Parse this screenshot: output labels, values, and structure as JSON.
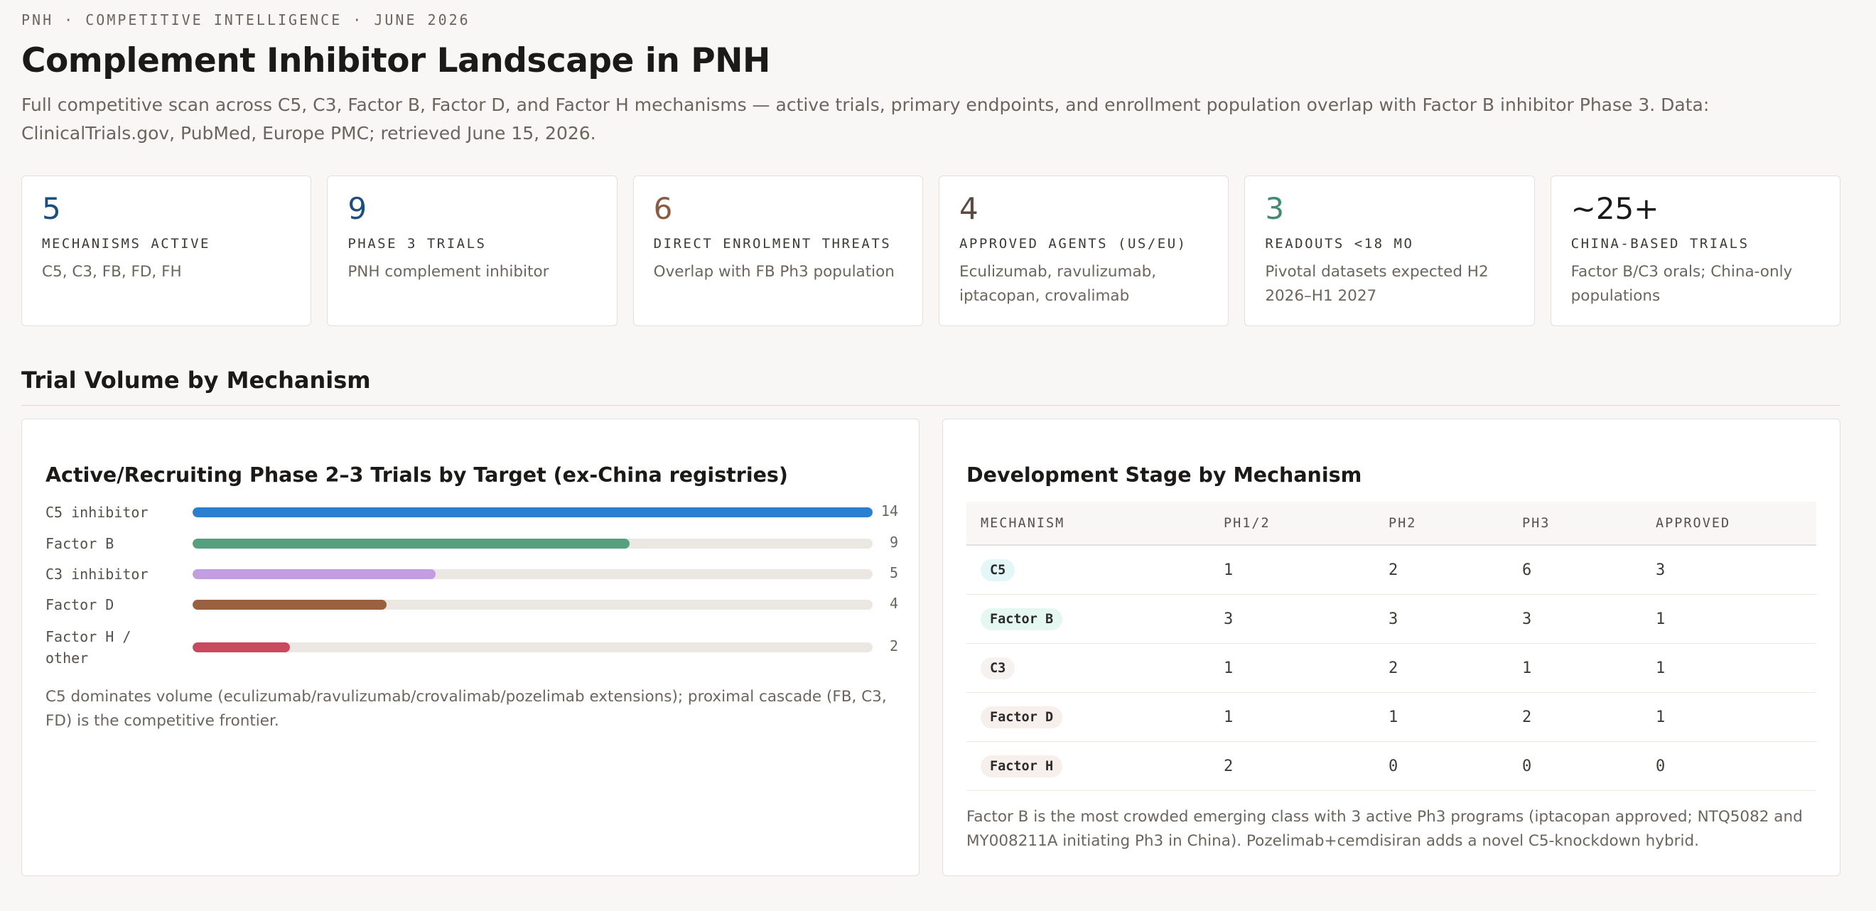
{
  "header": {
    "eyebrow": "PNH · COMPETITIVE INTELLIGENCE · JUNE 2026",
    "title": "Complement Inhibitor Landscape in PNH",
    "subtitle": "Full competitive scan across C5, C3, Factor B, Factor D, and Factor H mechanisms — active trials, primary endpoints, and enrollment population overlap with Factor B inhibitor Phase 3. Data: ClinicalTrials.gov, PubMed, Europe PMC; retrieved June 15, 2026."
  },
  "kpis": [
    {
      "value": "5",
      "label": "MECHANISMS ACTIVE",
      "desc": "C5, C3, FB, FD, FH",
      "color": "#1d4f7c"
    },
    {
      "value": "9",
      "label": "PHASE 3 TRIALS",
      "desc": "PNH complement inhibitor",
      "color": "#1d4f7c"
    },
    {
      "value": "6",
      "label": "DIRECT ENROLMENT THREATS",
      "desc": "Overlap with FB Ph3 population",
      "color": "#8c5a3f"
    },
    {
      "value": "4",
      "label": "APPROVED AGENTS (US/EU)",
      "desc": "Eculizumab, ravulizumab, iptacopan, crovalimab",
      "color": "#5c4a3e"
    },
    {
      "value": "3",
      "label": "READOUTS <18 MO",
      "desc": "Pivotal datasets expected H2 2026–H1 2027",
      "color": "#3f8c70"
    },
    {
      "value": "~25+",
      "label": "CHINA-BASED TRIALS",
      "desc": "Factor B/C3 orals; China-only populations",
      "color": "#1c1a18"
    }
  ],
  "section": {
    "title": "Trial Volume by Mechanism"
  },
  "bar_panel": {
    "title": "Active/Recruiting Phase 2–3 Trials by Target (ex-China registries)",
    "note": "C5 dominates volume (eculizumab/ravulizumab/crovalimab/pozelimab extensions); proximal cascade (FB, C3, FD) is the competitive frontier."
  },
  "chart_data": {
    "type": "bar",
    "orientation": "horizontal",
    "title": "Active/Recruiting Phase 2–3 Trials by Target (ex-China registries)",
    "categories": [
      "C5 inhibitor",
      "Factor B",
      "C3 inhibitor",
      "Factor D",
      "Factor H / other"
    ],
    "values": [
      14,
      9,
      5,
      4,
      2
    ],
    "colors": [
      "#2a7fce",
      "#55a07f",
      "#c29ddf",
      "#99613f",
      "#c94a5e"
    ],
    "xlim": [
      0,
      14
    ],
    "grid": false
  },
  "table_panel": {
    "title": "Development Stage by Mechanism",
    "columns": [
      "MECHANISM",
      "PH1/2",
      "PH2",
      "PH3",
      "APPROVED"
    ],
    "rows": [
      {
        "mechanism": "C5",
        "ph12": "1",
        "ph2": "2",
        "ph3": "6",
        "approved": "3",
        "pill_color": "#e3f6f8"
      },
      {
        "mechanism": "Factor B",
        "ph12": "3",
        "ph2": "3",
        "ph3": "3",
        "approved": "1",
        "pill_color": "#e4f7f1"
      },
      {
        "mechanism": "C3",
        "ph12": "1",
        "ph2": "2",
        "ph3": "1",
        "approved": "1",
        "pill_color": "#f6f2ef"
      },
      {
        "mechanism": "Factor D",
        "ph12": "1",
        "ph2": "1",
        "ph3": "2",
        "approved": "1",
        "pill_color": "#f6efeb"
      },
      {
        "mechanism": "Factor H",
        "ph12": "2",
        "ph2": "0",
        "ph3": "0",
        "approved": "0",
        "pill_color": "#f6efeb"
      }
    ],
    "note": "Factor B is the most crowded emerging class with 3 active Ph3 programs (iptacopan approved; NTQ5082 and MY008211A initiating Ph3 in China). Pozelimab+cemdisiran adds a novel C5-knockdown hybrid."
  }
}
